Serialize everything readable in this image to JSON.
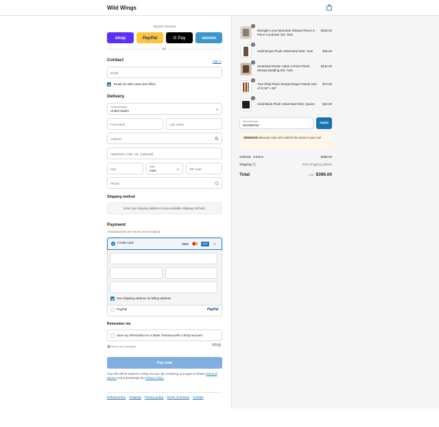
{
  "header": {
    "brand": "Wild Wings",
    "cart_icon": "shopping-bag-icon"
  },
  "express": {
    "label": "Express checkout",
    "or_label": "OR",
    "buttons": [
      {
        "label": "shop",
        "bg": "#5a31f4",
        "color": "#ffffff"
      },
      {
        "label": "PayPal",
        "bg": "#ffc439",
        "color": "#003087"
      },
      {
        "label": "G Pay",
        "bg": "#000000",
        "color": "#ffffff"
      },
      {
        "label": "venmo",
        "bg": "#3d95ce",
        "color": "#ffffff"
      }
    ]
  },
  "contact": {
    "title": "Contact",
    "sign_in": "Sign in",
    "email_placeholder": "Email",
    "news_label": "Email me with news and offers"
  },
  "delivery": {
    "title": "Delivery",
    "country_label": "Country/Region",
    "country_value": "United States",
    "first_name": "First name",
    "last_name": "Last name",
    "address": "Address",
    "apartment": "Apartment, suite, etc. (optional)",
    "city": "City",
    "state_label": "State",
    "state_value": "Iowa",
    "zip": "ZIP code",
    "phone": "Phone"
  },
  "shipping": {
    "title": "Shipping method",
    "message": "Enter your shipping address to view available shipping methods."
  },
  "payment": {
    "title": "Payment",
    "subtitle": "All transactions are secure and encrypted.",
    "credit_card_label": "Credit card",
    "more_cards": "+3",
    "billing_label": "Use shipping address as billing address",
    "paypal_label": "PayPal",
    "paypal_logo": "PayPal"
  },
  "remember": {
    "title": "Remember me",
    "save_label": "Save my information for a faster checkout with a Shop account",
    "secure_label": "Secure and encrypted",
    "shop_logo": "shop"
  },
  "pay_button": "Pay now",
  "legal": {
    "text_before": "Your info will be saved to a Shop account. By continuing, you agree to Shop's",
    "terms": "Terms of Service",
    "and_text": "and acknowledge the",
    "privacy": "Privacy Policy."
  },
  "footer_links": [
    "Refund policy",
    "Shipping",
    "Privacy policy",
    "Terms of service",
    "Contact"
  ],
  "cart": {
    "items": [
      {
        "name": "Wrangler Lone Mountain Sherpa Fleece 3-Piece Comforter Set, Twin",
        "price": "$108.00",
        "qty": "1"
      },
      {
        "name": "Solid Brown Plush Velvet Bed Skirt, Twin",
        "price": "$36.00",
        "qty": "1"
      },
      {
        "name": "Hinterland Rustic Cabin 4-Piece Plush Sherpa Bedding Set, Twin",
        "price": "$140.00",
        "qty": "1"
      },
      {
        "name": "Tree Plaid Plush Sherpa Drape Panels (Set of 2) 54\" x 84\"",
        "price": "$70.00",
        "qty": "1"
      },
      {
        "name": "Solid Black Plush Velvet Bed Skirt, Queen",
        "price": "$42.00",
        "qty": "1"
      }
    ],
    "discount_label": "Discount code",
    "discount_value": "WINNER20",
    "apply_label": "Apply",
    "error_code": "WINNER20",
    "error_text": " discount code isn't valid for the items in your cart",
    "subtotal_label": "Subtotal · 5 items",
    "subtotal_value": "$396.00",
    "shipping_label": "Shipping",
    "shipping_value": "Enter shipping address",
    "total_label": "Total",
    "currency": "USD",
    "total_value": "$396.00"
  }
}
